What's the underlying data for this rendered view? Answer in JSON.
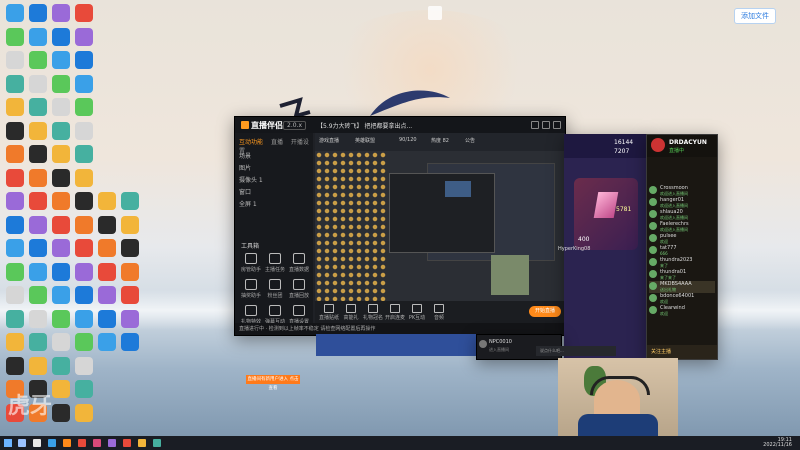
{
  "desktop": {
    "corner_button": "添加文件",
    "watermark": "虎牙"
  },
  "streamer_app": {
    "logo": "直播伴侣",
    "version": "2.0.x",
    "stream_title": "【5.9力大砖飞】 把把都要拿出点...",
    "tabs": [
      "互动功能",
      "直播",
      "开播设置"
    ],
    "scenes": [
      "场景",
      "图片",
      "摄像头 1",
      "窗口",
      "全屏 1"
    ],
    "tools_title": "工具箱",
    "tools": [
      "房管助手",
      "主播任务",
      "直播数据",
      "抽奖助手",
      "粉丝团",
      "直播回放",
      "礼物特效",
      "弹幕互动",
      "直播设置"
    ],
    "stream_chips": [
      "游戏直播",
      "英雄联盟",
      "90/120",
      "热度 82",
      "公告"
    ],
    "toolbar": [
      "直播贴纸",
      "高能礼",
      "礼物冠名",
      "开启连麦",
      "PK互动",
      "音频"
    ],
    "live_button": "开始直播",
    "status": "直播进行中 · 检测到以上帧率不稳定 请检查网络配置后再操作"
  },
  "game": {
    "stats": [
      "16144",
      "7207"
    ],
    "gem_count": "5781",
    "price": "400",
    "player": "HyperKing08"
  },
  "chat": {
    "user": "DRDACYUN",
    "subtitle": "直播中",
    "items": [
      {
        "name": "Crossmoon",
        "msg": "欢迎进入直播间"
      },
      {
        "name": "hanger01",
        "msg": "欢迎进入直播间"
      },
      {
        "name": "shlaua20",
        "msg": "欢迎进入直播间"
      },
      {
        "name": "Faelerechrs",
        "msg": "欢迎进入直播间"
      },
      {
        "name": "pulsee",
        "msg": "欢迎"
      },
      {
        "name": "tat777",
        "msg": "666"
      },
      {
        "name": "thundra2023",
        "msg": "来了"
      },
      {
        "name": "thundra01",
        "msg": "来了来了"
      },
      {
        "name": "MKDBS4AAA",
        "msg": "送出礼物"
      },
      {
        "name": "bdonce64001",
        "msg": "欢迎"
      },
      {
        "name": "Clearwind",
        "msg": "欢迎"
      }
    ],
    "footer": "关注主播"
  },
  "np_user": {
    "name": "NPC0010",
    "sub": "进入直播间",
    "input_placeholder": "说点什么吧..."
  },
  "toast": "直播间有新用户进入 点击查看",
  "taskbar": {
    "time": "19:11",
    "date": "2022/11/16"
  }
}
